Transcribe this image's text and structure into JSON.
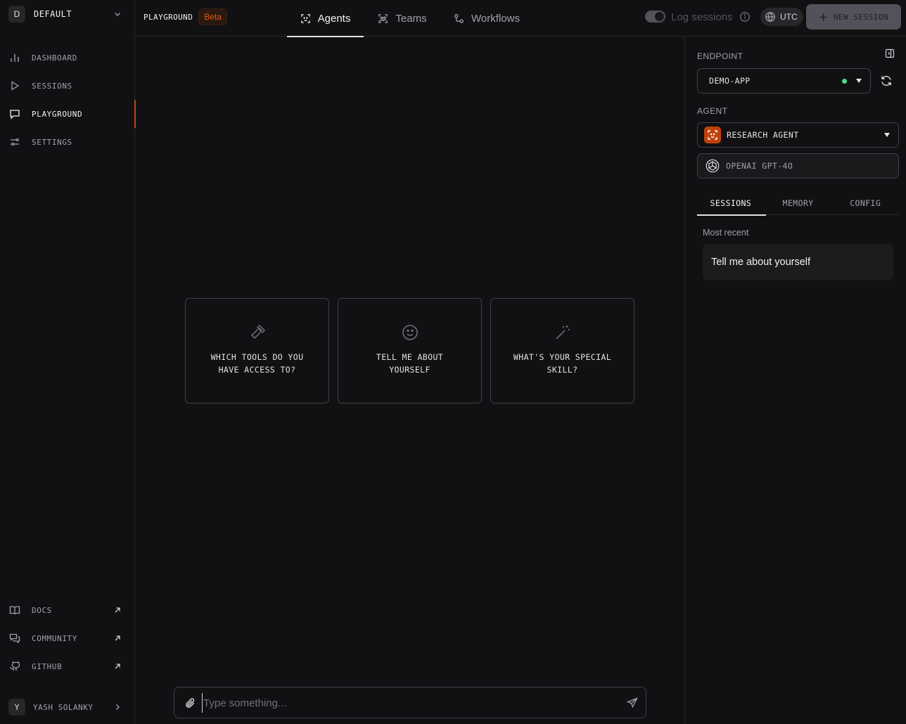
{
  "workspace": {
    "initial": "D",
    "name": "DEFAULT"
  },
  "sidebar": {
    "nav": [
      {
        "label": "DASHBOARD"
      },
      {
        "label": "SESSIONS"
      },
      {
        "label": "PLAYGROUND"
      },
      {
        "label": "SETTINGS"
      }
    ],
    "links": [
      {
        "label": "DOCS"
      },
      {
        "label": "COMMUNITY"
      },
      {
        "label": "GITHUB"
      }
    ],
    "user": {
      "initial": "Y",
      "name": "YASH SOLANKY"
    }
  },
  "topbar": {
    "title": "PLAYGROUND",
    "badge": "Beta",
    "tabs": [
      {
        "label": "Agents",
        "icon": "agents-icon",
        "active": true
      },
      {
        "label": "Teams",
        "icon": "teams-icon",
        "active": false
      },
      {
        "label": "Workflows",
        "icon": "workflows-icon",
        "active": false
      }
    ],
    "log_sessions_label": "Log sessions",
    "log_sessions_enabled": true,
    "timezone": "UTC",
    "new_session_label": "NEW SESSION"
  },
  "main": {
    "suggestions": [
      {
        "icon": "hammer-icon",
        "text": "WHICH TOOLS DO YOU HAVE ACCESS TO?"
      },
      {
        "icon": "smile-icon",
        "text": "TELL ME ABOUT YOURSELF"
      },
      {
        "icon": "magic-wand-icon",
        "text": "WHAT'S YOUR SPECIAL SKILL?"
      }
    ],
    "chat_placeholder": "Type something..."
  },
  "panel": {
    "endpoint_label": "ENDPOINT",
    "endpoint_value": "DEMO-APP",
    "endpoint_status_color": "#4ade80",
    "agent_label": "AGENT",
    "agent_value": "RESEARCH AGENT",
    "agent_color": "#c2410c",
    "model_value": "OPENAI GPT-4O",
    "tabs": [
      {
        "label": "SESSIONS",
        "active": true
      },
      {
        "label": "MEMORY",
        "active": false
      },
      {
        "label": "CONFIG",
        "active": false
      }
    ],
    "recent_label": "Most recent",
    "sessions": [
      {
        "title": "Tell me about yourself"
      }
    ]
  },
  "colors": {
    "accent": "#c2410c",
    "background": "#111113",
    "border": "#27272a"
  }
}
